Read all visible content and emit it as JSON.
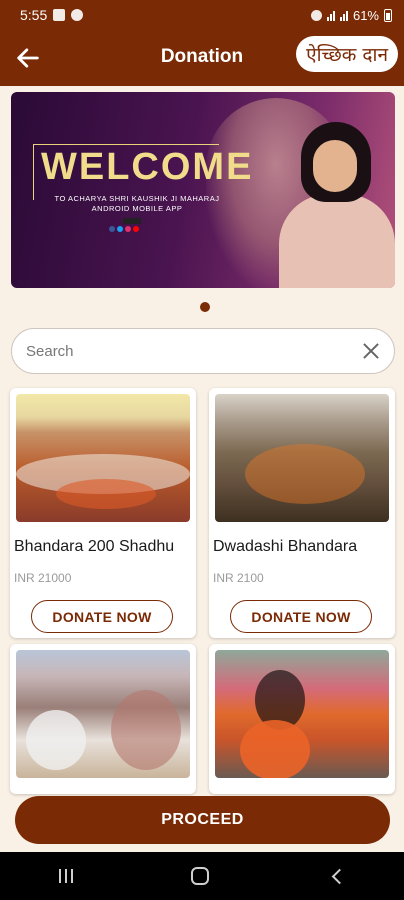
{
  "status_bar": {
    "time": "5:55",
    "battery": "61%"
  },
  "app_bar": {
    "title": "Donation",
    "optional_donation_label": "ऐच्छिक दान"
  },
  "banner": {
    "headline": "WELCOME",
    "subline": "TO ACHARYA SHRI KAUSHIK JI MAHARAJ ANDROID MOBILE APP"
  },
  "search": {
    "placeholder": "Search",
    "value": ""
  },
  "cards": [
    {
      "name": "Bhandara 200 Shadhu",
      "price": "INR 21000",
      "button": "DONATE NOW"
    },
    {
      "name": "Dwadashi Bhandara",
      "price": "INR 2100",
      "button": "DONATE NOW"
    },
    {
      "name": "",
      "price": "",
      "button": ""
    },
    {
      "name": "",
      "price": "",
      "button": ""
    }
  ],
  "proceed_label": "PROCEED",
  "colors": {
    "primary": "#7a2a05",
    "background": "#faf1e6"
  },
  "icons": [
    "back-arrow-icon",
    "clear-icon",
    "recents-icon",
    "home-icon",
    "system-back-icon"
  ]
}
